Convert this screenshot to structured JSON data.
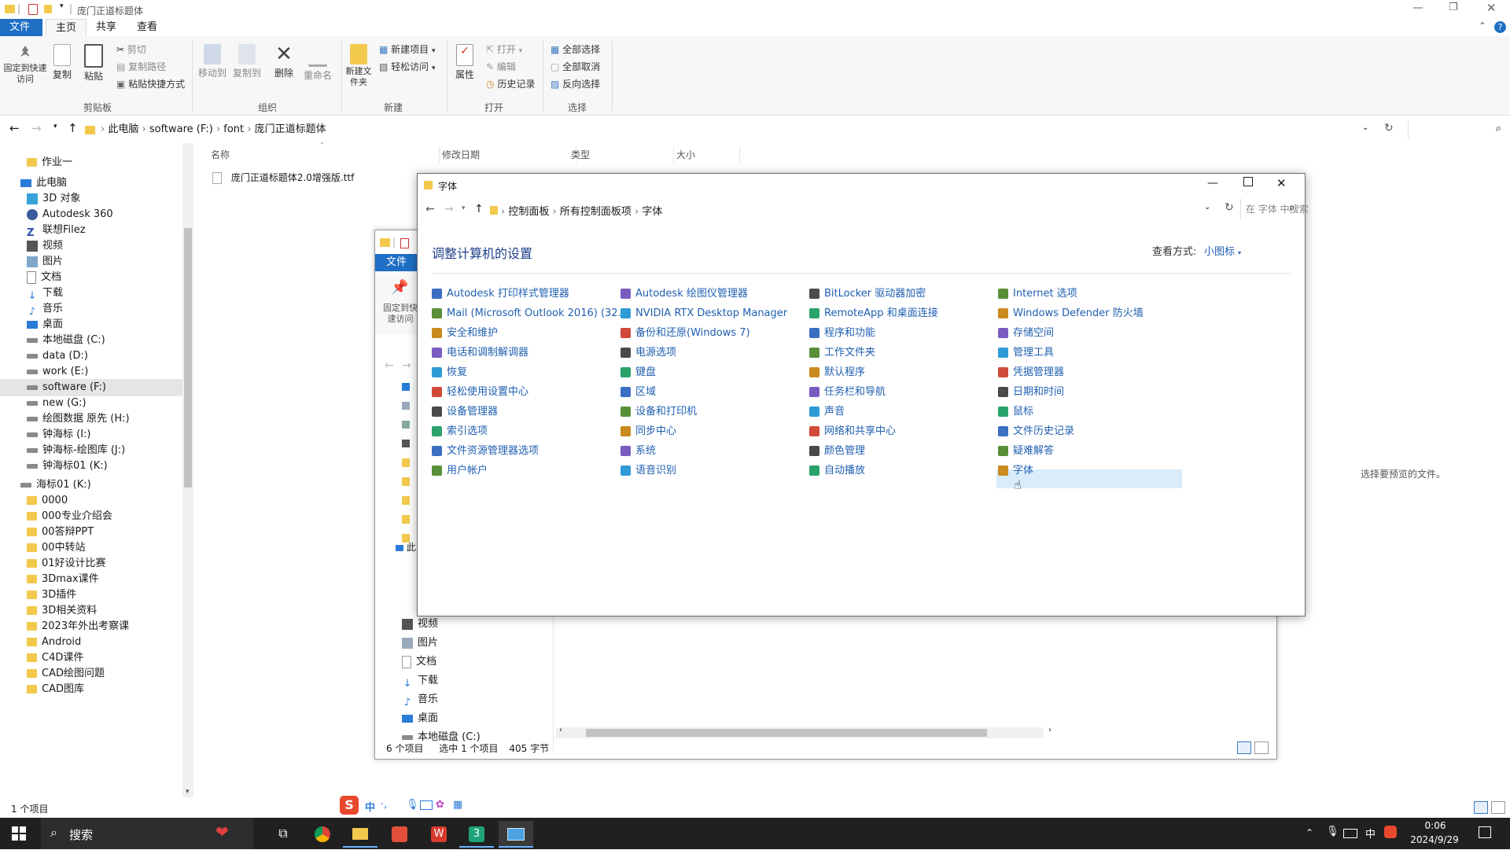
{
  "main_window": {
    "title": "庞门正道标题体",
    "ribbon_tabs": [
      "文件",
      "主页",
      "共享",
      "查看"
    ],
    "ribbon": {
      "pin_label": "固定到快速访问",
      "copy_label": "复制",
      "paste_label": "粘贴",
      "cut_label": "剪切",
      "copy_path_label": "复制路径",
      "paste_shortcut_label": "粘贴快捷方式",
      "clipboard_group": "剪贴板",
      "move_to_label": "移动到",
      "copy_to_label": "复制到",
      "delete_label": "删除",
      "rename_label": "重命名",
      "organize_group": "组织",
      "new_folder_label": "新建文件夹",
      "new_item_label": "新建项目",
      "easy_access_label": "轻松访问",
      "new_group": "新建",
      "properties_label": "属性",
      "open_label": "打开",
      "edit_label": "编辑",
      "history_label": "历史记录",
      "open_group": "打开",
      "select_all_label": "全部选择",
      "select_none_label": "全部取消",
      "invert_selection_label": "反向选择",
      "select_group": "选择"
    },
    "breadcrumb": [
      "此电脑",
      "software (F:)",
      "font",
      "庞门正道标题体"
    ],
    "columns": [
      "名称",
      "修改日期",
      "类型",
      "大小"
    ],
    "file_name": "庞门正道标题体2.0增强版.ttf",
    "preview_text": "选择要预览的文件。",
    "status_text": "1 个项目",
    "nav_items": [
      "作业一",
      "此电脑",
      "3D 对象",
      "Autodesk 360",
      "联想Filez",
      "视频",
      "图片",
      "文档",
      "下载",
      "音乐",
      "桌面",
      "本地磁盘 (C:)",
      "data (D:)",
      "work (E:)",
      "software (F:)",
      "new (G:)",
      "绘图数据 原先 (H:)",
      "钟海标 (I:)",
      "钟海标-绘图库 (J:)",
      "钟海标01 (K:)",
      "海标01 (K:)",
      "0000",
      "000专业介绍会",
      "00答辩PPT",
      "00中转站",
      "01好设计比赛",
      "3Dmax课件",
      "3D插件",
      "3D相关资料",
      "2023年外出考察课",
      "Android",
      "C4D课件",
      "CAD绘图问题",
      "CAD图库"
    ]
  },
  "bg_window": {
    "file_tab": "文件",
    "pin_label": "固定到快速访问",
    "nav_items": [
      "视频",
      "图片",
      "文档",
      "下载",
      "音乐",
      "桌面",
      "本地磁盘 (C:)"
    ],
    "nav_partial": "此",
    "status_count": "6 个项目",
    "status_selected": "选中 1 个项目",
    "status_size": "405 字节"
  },
  "control_panel": {
    "title": "字体",
    "breadcrumb": [
      "控制面板",
      "所有控制面板项",
      "字体"
    ],
    "search_placeholder": "在 字体 中搜索",
    "heading": "调整计算机的设置",
    "view_by_label": "查看方式:",
    "view_by_value": "小图标",
    "columns": [
      [
        "Autodesk 打印样式管理器",
        "Mail (Microsoft Outlook 2016) (32...",
        "安全和维护",
        "电话和调制解调器",
        "恢复",
        "轻松使用设置中心",
        "设备管理器",
        "索引选项",
        "文件资源管理器选项",
        "用户帐户"
      ],
      [
        "Autodesk 绘图仪管理器",
        "NVIDIA RTX Desktop Manager",
        "备份和还原(Windows 7)",
        "电源选项",
        "键盘",
        "区域",
        "设备和打印机",
        "同步中心",
        "系统",
        "语音识别"
      ],
      [
        "BitLocker 驱动器加密",
        "RemoteApp 和桌面连接",
        "程序和功能",
        "工作文件夹",
        "默认程序",
        "任务栏和导航",
        "声音",
        "网络和共享中心",
        "颜色管理",
        "自动播放"
      ],
      [
        "Internet 选项",
        "Windows Defender 防火墙",
        "存储空间",
        "管理工具",
        "凭据管理器",
        "日期和时间",
        "鼠标",
        "文件历史记录",
        "疑难解答",
        "字体"
      ]
    ],
    "icon_colors": [
      "#3b6fc2",
      "#5a8f3a",
      "#c98a1e",
      "#7a5cc0",
      "#2e9bd6",
      "#d04a3a",
      "#4a4a4a",
      "#2aa36b"
    ]
  },
  "ime_bar": [
    "S",
    "中",
    "·,",
    "mic",
    "kbd",
    "skin",
    "grid"
  ],
  "taskbar": {
    "search_label": "搜索",
    "time": "0:06",
    "date": "2024/9/29",
    "ime_indicator": "中"
  }
}
